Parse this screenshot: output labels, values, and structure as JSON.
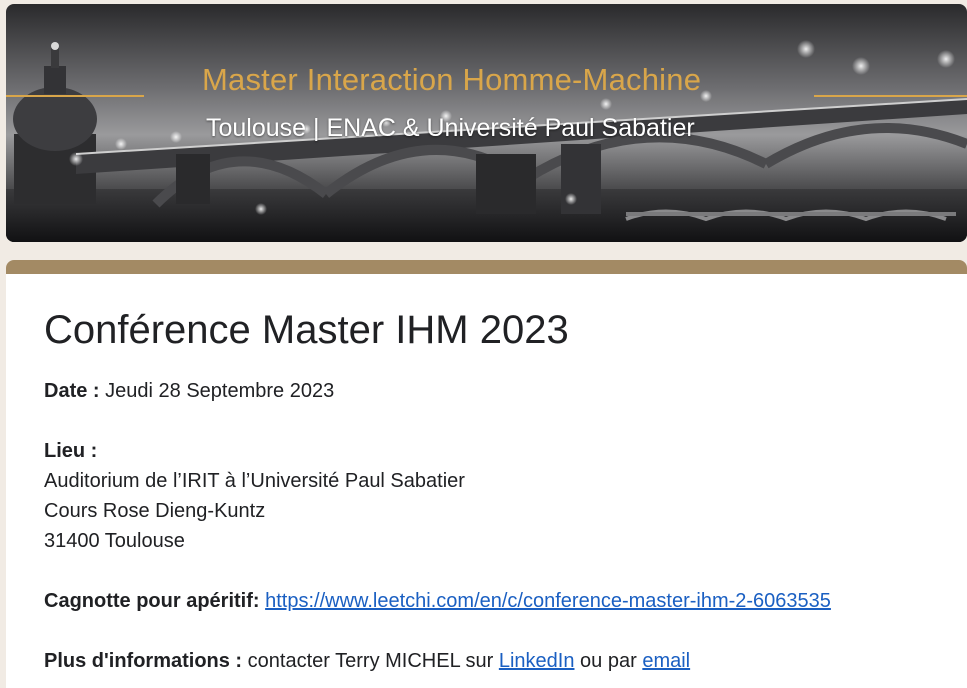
{
  "banner": {
    "title": "Master Interaction Homme-Machine",
    "subtitle": "Toulouse | ENAC & Université Paul Sabatier",
    "accent_color": "#d9a64a"
  },
  "form": {
    "title": "Conférence Master IHM 2023",
    "accent_color": "#a38a64",
    "date": {
      "label": "Date :",
      "value": "Jeudi 28 Septembre 2023"
    },
    "lieu": {
      "label": "Lieu :",
      "line1": "Auditorium de l’IRIT à l’Université Paul Sabatier",
      "line2": "Cours Rose Dieng-Kuntz",
      "line3": "31400 Toulouse"
    },
    "cagnotte": {
      "label": "Cagnotte pour apéritif:",
      "link": "https://www.leetchi.com/en/c/conference-master-ihm-2-6063535"
    },
    "info": {
      "label": "Plus d'informations :",
      "text1": "contacter Terry MICHEL sur",
      "linkedin": "LinkedIn",
      "text2": "ou par",
      "email": "email"
    },
    "link_color": "#1a5fc2"
  }
}
